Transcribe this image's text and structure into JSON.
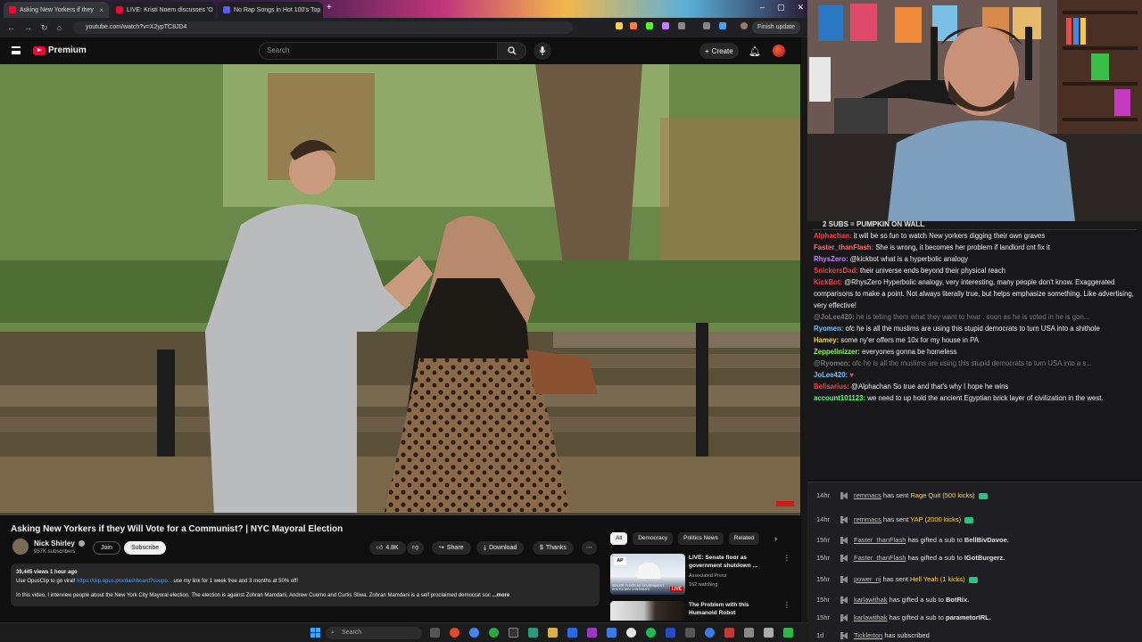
{
  "browser": {
    "tabs": [
      {
        "label": "Asking New Yorkers if they",
        "color": "#ff0033"
      },
      {
        "label": "LIVE: Kristi Noem discusses 'O",
        "color": "#ff0033"
      },
      {
        "label": "No Rap Songs in Hot 100's Top",
        "color": "#5b5bff"
      }
    ],
    "url": "youtube.com/watch?v=X2ypTC8JD4",
    "finish_update": "Finish update"
  },
  "youtube": {
    "logo_text": "Premium",
    "search_placeholder": "Search",
    "create_label": "Create",
    "video": {
      "title": "Asking New Yorkers if they Will Vote for a Communist? | NYC Mayoral Election",
      "channel": "Nick Shirley",
      "subscribers": "957K subscribers",
      "join_label": "Join",
      "subscribe_label": "Subscribe",
      "likes": "4.8K",
      "share_label": "Share",
      "download_label": "Download",
      "thanks_label": "Thanks",
      "views_time": "39,445 views  1 hour ago",
      "desc_line1_pre": "Use OpusClip to go viral! ",
      "desc_link": "https://clip.opus.pro/dashboard?coupo...",
      "desc_line1_post": "  use my link for 1 week free and 3 months at 50% off!",
      "desc_line2": "In this video, I interview people about the New York City Mayoral election. The election is against Zohran Mamdani, Andrew Cuomo and Curtis Sliwa. Zohran Mamdani is a self proclaimed democrat soc",
      "desc_more": "...more",
      "progress": 0.0
    },
    "chips": [
      "All",
      "Democracy",
      "Politics News",
      "Related"
    ],
    "recommendations": [
      {
        "title": "LIVE: Senate floor as government shutdown ...",
        "channel": "Associated Press",
        "meta": "162 watching",
        "badge": "LIVE",
        "thumb_caption": "SENATE FLOOR AS GOVERNMENT SHUTDOWN CONTINUES"
      },
      {
        "title": "The Problem with this Humanoid Robot",
        "channel": "",
        "meta": "",
        "badge": "",
        "thumb_caption": ""
      }
    ]
  },
  "stream": {
    "chat_header": "2 SUBS = PUMPKIN ON WALL",
    "messages": [
      {
        "user": "Alphachan:",
        "user_color": "#ff4040",
        "text": "it will be so fun to watch New yorkers digging their own graves",
        "faded": false
      },
      {
        "user": "Faster_thanFlash:",
        "user_color": "#ff6b6b",
        "text": "She is wrong, it becomes her problem if landlord cnt fix it",
        "faded": false
      },
      {
        "user": "RhysZero:",
        "user_color": "#c77dff",
        "text": "@kickbot what is a hyperbolic analogy",
        "faded": false
      },
      {
        "user": "SnickersDad:",
        "user_color": "#ff3b3b",
        "text": "their universe ends beyond their physical reach",
        "faded": false
      },
      {
        "user": "KickBot:",
        "user_color": "#ff3b3b",
        "text": "@RhysZero Hyperbolic analogy, very interesting, many people don't know. Exaggerated comparisons to make a point. Not always literally true, but helps emphasize something. Like advertising, very effective!",
        "faded": false
      },
      {
        "user": "@JoLee420:",
        "user_color": "#777777",
        "text": "he is telling them what they want to hear . soon as he is voted in he is gon...",
        "faded": true
      },
      {
        "user": "Ryomen:",
        "user_color": "#6fc3ff",
        "text": "ofc he is all the muslims are using this stupid democrats to turn USA into a shithole",
        "faded": false
      },
      {
        "user": "Hamey:",
        "user_color": "#ffd24a",
        "text": "some ny'er offers me 10x for my house in PA",
        "faded": false
      },
      {
        "user": "Zeppelinizzer:",
        "user_color": "#8cff5a",
        "text": "everyones gonna be homeless",
        "faded": false
      },
      {
        "user": "@Ryomen:",
        "user_color": "#777777",
        "text": "ofc he is all the muslims are using this stupid democrats to turn USA into a s...",
        "faded": true
      },
      {
        "user": "JoLee420:",
        "user_color": "#6fc3ff",
        "text": "♥",
        "faded": false
      },
      {
        "user": "Belisarius:",
        "user_color": "#ff3b3b",
        "text": "@Alphachan So true and that's why I hope he wins",
        "faded": false
      },
      {
        "user": "account101123:",
        "user_color": "#5aff7a",
        "text": "we need to up hold the ancient Egyptian brick layer of civilization in the west.",
        "faded": false
      }
    ],
    "events": [
      {
        "time": "14hr",
        "user": "remmacs",
        "text": " has sent ",
        "item": "Rage Quit (500 kicks)",
        "gem": true,
        "bold": false
      },
      {
        "time": "14hr",
        "user": "remmacs",
        "text": " has sent ",
        "item": "YAP (2000 kicks)",
        "gem": true,
        "bold": false
      },
      {
        "time": "15hr",
        "user": "Faster_thanFlash",
        "text": " has gifted a sub to ",
        "item": "BellBivDavoe.",
        "gem": false,
        "bold": true
      },
      {
        "time": "15hr",
        "user": "Faster_thanFlash",
        "text": " has gifted a sub to ",
        "item": "IGotBurgerz.",
        "gem": false,
        "bold": true
      },
      {
        "time": "15hr",
        "user": "power_nj",
        "text": " has sent ",
        "item": "Hell Yeah (1 kicks)",
        "gem": true,
        "bold": false
      },
      {
        "time": "15hr",
        "user": "karlawithak",
        "text": " has gifted a sub to ",
        "item": "BotRix.",
        "gem": false,
        "bold": true
      },
      {
        "time": "15hr",
        "user": "karlawithak",
        "text": " has gifted a sub to ",
        "item": "parametorIRL.",
        "gem": false,
        "bold": true
      },
      {
        "time": "1d",
        "user": "Ticklerton",
        "text": " has subscribed",
        "item": "",
        "gem": false,
        "bold": false
      }
    ]
  },
  "taskbar": {
    "search_label": "Search"
  },
  "colors": {
    "yt_red": "#ff0033",
    "kick_green": "#53fc18",
    "chat_bg": "#18181b"
  }
}
